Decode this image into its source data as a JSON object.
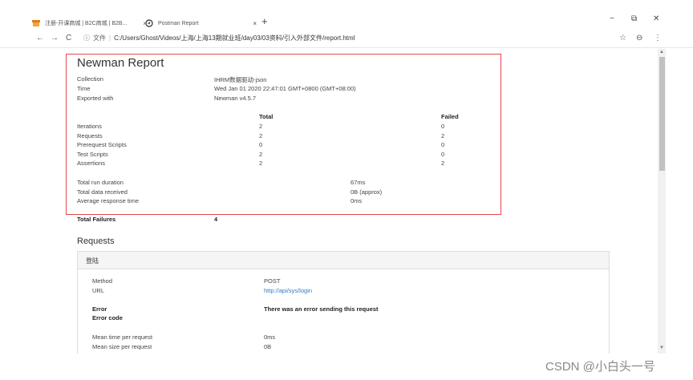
{
  "browser": {
    "tabs": [
      {
        "title": "注册-开课商城 | B2C商城 | B2B..."
      },
      {
        "title": "Postman Report"
      }
    ],
    "tab_close_glyph": "×",
    "new_tab_glyph": "+",
    "window": {
      "minimize": "−",
      "maximize": "⧉",
      "close": "✕"
    },
    "nav": {
      "back": "←",
      "forward": "→",
      "reload": "C"
    },
    "url_info": "ⓘ",
    "url_protocol": "文件",
    "url_separator": "|",
    "url": "C:/Users/Ghost/Videos/上海/上海13期就业班/day03/03资料/引入外部文件/report.html",
    "star": "☆",
    "profile": "⊖",
    "menu": "⋮",
    "icons": {
      "tab1": "shop-favicon",
      "tab2": "postman-favicon"
    },
    "colors": {
      "highlight_border": "#e5484d",
      "link": "#2f7bc4"
    }
  },
  "report": {
    "title": "Newman Report",
    "info": [
      {
        "label": "Collection",
        "value": "IHRM数据驱动-json"
      },
      {
        "label": "Time",
        "value": "Wed Jan 01 2020 22:47:01 GMT+0800 (GMT+08:00)"
      },
      {
        "label": "Exported with",
        "value": "Newman v4.5.7"
      }
    ],
    "stats_header": {
      "total": "Total",
      "failed": "Failed"
    },
    "stats": [
      {
        "label": "Iterations",
        "total": "2",
        "failed": "0"
      },
      {
        "label": "Requests",
        "total": "2",
        "failed": "2"
      },
      {
        "label": "Prerequest Scripts",
        "total": "0",
        "failed": "0"
      },
      {
        "label": "Test Scripts",
        "total": "2",
        "failed": "0"
      },
      {
        "label": "Assertions",
        "total": "2",
        "failed": "2"
      }
    ],
    "timings": [
      {
        "label": "Total run duration",
        "value": "67ms"
      },
      {
        "label": "Total data received",
        "value": "0B (approx)"
      },
      {
        "label": "Average response time",
        "value": "0ms"
      }
    ],
    "failures": {
      "label": "Total Failures",
      "value": "4"
    },
    "requests_title": "Requests",
    "request": {
      "name": "登陆",
      "method_label": "Method",
      "method": "POST",
      "url_label": "URL",
      "url": "http://api/sys/login",
      "error_label": "Error",
      "error": "There was an error sending this request",
      "error_code_label": "Error code",
      "mean_time_label": "Mean time per request",
      "mean_time": "0ms",
      "mean_size_label": "Mean size per request",
      "mean_size": "0B"
    }
  },
  "watermark": "CSDN @小白头一号"
}
